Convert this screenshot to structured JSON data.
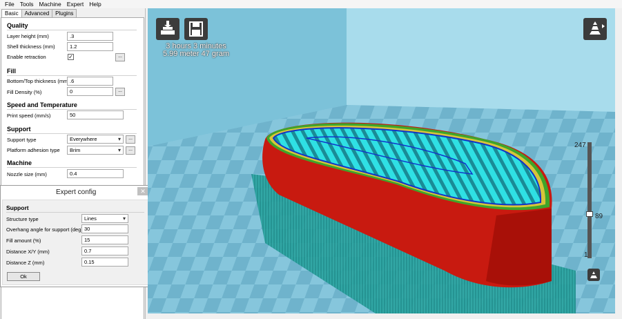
{
  "menu": [
    "File",
    "Tools",
    "Machine",
    "Expert",
    "Help"
  ],
  "tabs": [
    "Basic",
    "Advanced",
    "Plugins"
  ],
  "basic": {
    "quality": {
      "title": "Quality",
      "layer_height_label": "Layer height (mm)",
      "layer_height": ".3",
      "shell_thickness_label": "Shell thickness (mm)",
      "shell_thickness": "1.2",
      "retraction_label": "Enable retraction",
      "retraction_checked": "✓"
    },
    "fill": {
      "title": "Fill",
      "bottom_top_label": "Bottom/Top thickness (mm)",
      "bottom_top": ".6",
      "density_label": "Fill Density (%)",
      "density": "0"
    },
    "speed": {
      "title": "Speed and Temperature",
      "print_speed_label": "Print speed (mm/s)",
      "print_speed": "50"
    },
    "support": {
      "title": "Support",
      "support_type_label": "Support type",
      "support_type": "Everywhere",
      "adhesion_label": "Platform adhesion type",
      "adhesion": "Brim"
    },
    "machine": {
      "title": "Machine",
      "nozzle_label": "Nozzle size (mm)",
      "nozzle": "0.4"
    },
    "dots": "..."
  },
  "expert": {
    "title": "Expert config",
    "close": "✕",
    "section": "Support",
    "structure_label": "Structure type",
    "structure": "Lines",
    "overhang_label": "Overhang angle for support (deg)",
    "overhang": "30",
    "fill_amount_label": "Fill amount (%)",
    "fill_amount": "15",
    "dist_xy_label": "Distance X/Y (mm)",
    "dist_xy": "0.7",
    "dist_z_label": "Distance Z (mm)",
    "dist_z": "0.15",
    "ok": "Ok"
  },
  "viewport": {
    "print_time": "3 hours 3 minutes",
    "material": "5.99 meter 47 gram",
    "layer_max": "247",
    "layer_current": "89",
    "layer_min": "1",
    "icons": [
      "load-model-icon",
      "save-toolpath-icon",
      "view-mode-icon",
      "layer-view-icon"
    ]
  }
}
